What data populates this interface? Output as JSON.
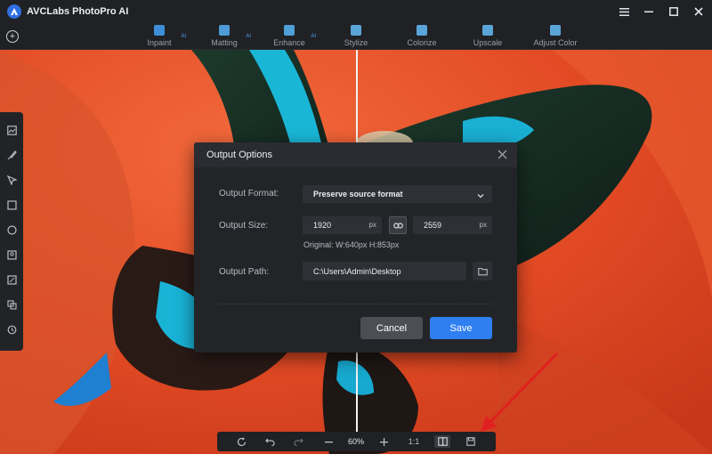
{
  "app": {
    "title": "AVCLabs PhotoPro AI",
    "accent": "#2f7ff0"
  },
  "window_controls": {
    "menu_icon": "hamburger-icon",
    "minimize_icon": "minimize-icon",
    "maximize_icon": "maximize-icon",
    "close_icon": "close-icon"
  },
  "toolbar": {
    "add_icon": "plus-circle-icon",
    "tools": [
      {
        "label": "Inpaint",
        "badge": "AI",
        "icon": "inpaint-icon"
      },
      {
        "label": "Matting",
        "badge": "AI",
        "icon": "matting-icon"
      },
      {
        "label": "Enhance",
        "badge": "AI",
        "icon": "enhance-icon"
      },
      {
        "label": "Stylize",
        "badge": "",
        "icon": "stylize-icon"
      },
      {
        "label": "Colorize",
        "badge": "",
        "icon": "colorize-icon"
      },
      {
        "label": "Upscale",
        "badge": "",
        "icon": "upscale-icon"
      },
      {
        "label": "Adjust Color",
        "badge": "",
        "icon": "adjust-color-icon"
      }
    ]
  },
  "left_rail": {
    "icons": [
      "image-icon",
      "brush-icon",
      "select-arrow-icon",
      "rectangle-icon",
      "circle-icon",
      "portrait-icon",
      "edit-icon",
      "layers-icon",
      "history-icon"
    ]
  },
  "dialog": {
    "title": "Output Options",
    "format_label": "Output Format:",
    "format_value": "Preserve source format",
    "size_label": "Output Size:",
    "width_value": "1920",
    "height_value": "2559",
    "unit": "px",
    "original_text": "Original:  W:640px  H:853px",
    "path_label": "Output Path:",
    "path_value": "C:\\Users\\Admin\\Desktop",
    "cancel_label": "Cancel",
    "save_label": "Save"
  },
  "bottom_bar": {
    "zoom": "60%",
    "ratio": "1:1"
  }
}
